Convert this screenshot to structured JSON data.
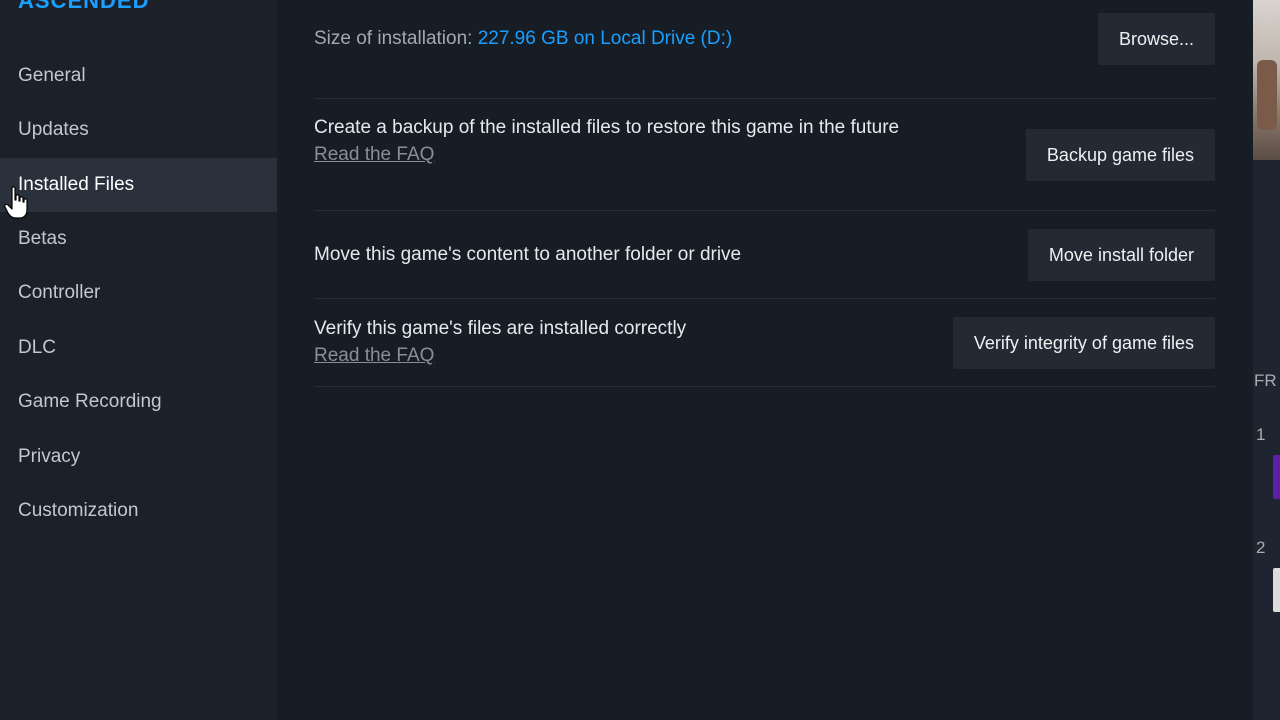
{
  "game": {
    "title": "ASCENDED"
  },
  "sidebar": {
    "items": [
      {
        "label": "General",
        "active": false
      },
      {
        "label": "Updates",
        "active": false
      },
      {
        "label": "Installed Files",
        "active": true
      },
      {
        "label": "Betas",
        "active": false
      },
      {
        "label": "Controller",
        "active": false
      },
      {
        "label": "DLC",
        "active": false
      },
      {
        "label": "Game Recording",
        "active": false
      },
      {
        "label": "Privacy",
        "active": false
      },
      {
        "label": "Customization",
        "active": false
      }
    ]
  },
  "installed_files": {
    "size": {
      "label": "Size of installation:",
      "value": "227.96 GB on Local Drive (D:)",
      "button": "Browse..."
    },
    "backup": {
      "description": "Create a backup of the installed files to restore this game in the future",
      "faq_link": "Read the FAQ",
      "button": "Backup game files"
    },
    "move": {
      "description": "Move this game's content to another folder or drive",
      "button": "Move install folder"
    },
    "verify": {
      "description": "Verify this game's files are installed correctly",
      "faq_link": "Read the FAQ",
      "button": "Verify integrity of game files"
    }
  },
  "background_peek": {
    "text_fr": "FR",
    "num_1": "1",
    "num_2": "2"
  },
  "colors": {
    "accent": "#1a9fff",
    "background": "#171d25",
    "sidebar": "#1b2029",
    "active_item": "#2a313c",
    "button": "#232a34"
  },
  "icons": {
    "cursor": "hand-pointer-icon"
  }
}
